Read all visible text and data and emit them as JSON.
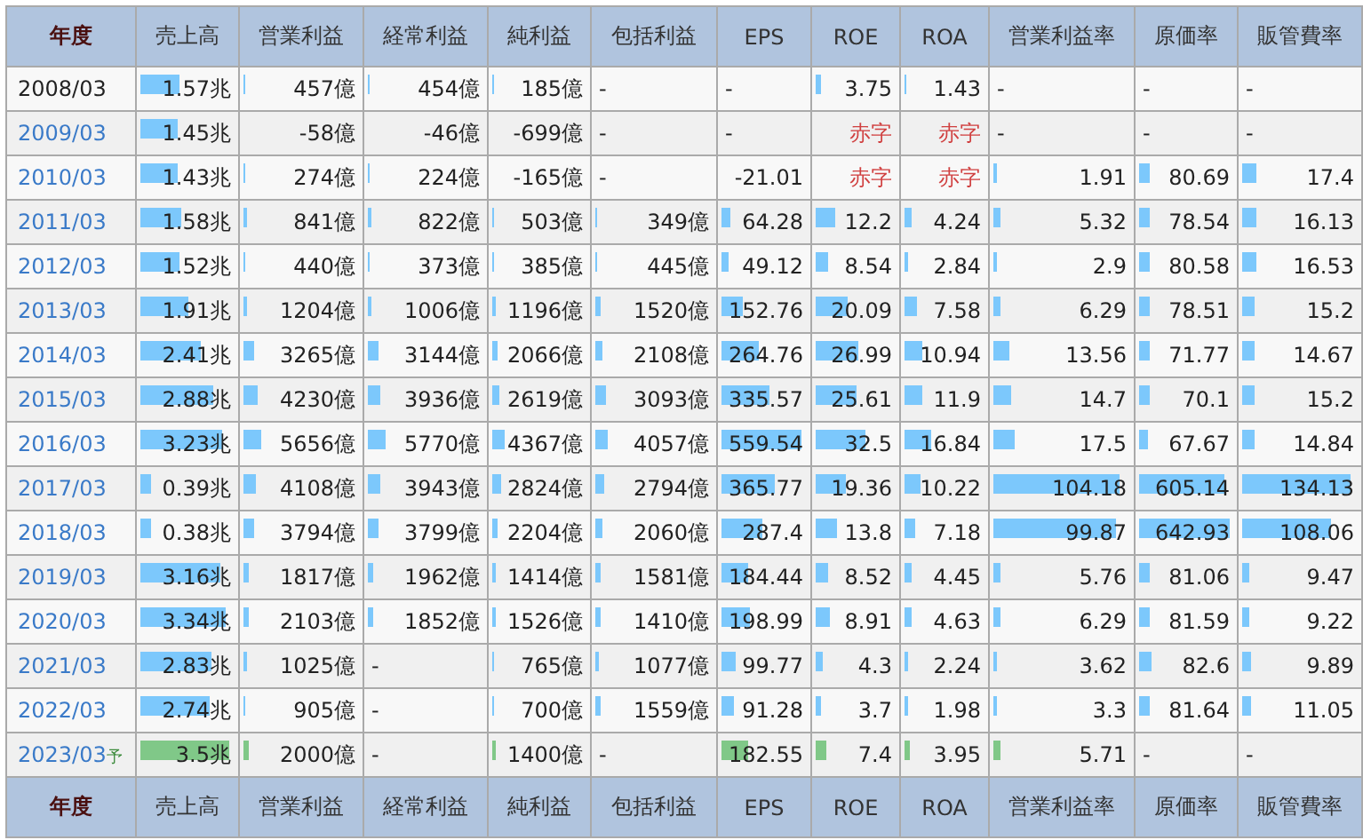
{
  "header": [
    "年度",
    "売上高",
    "営業利益",
    "経常利益",
    "純利益",
    "包括利益",
    "EPS",
    "ROE",
    "ROA",
    "営業利益率",
    "原価率",
    "販管費率"
  ],
  "rows": [
    {
      "year": "2008/03",
      "link": false,
      "forecast": false,
      "cells": [
        {
          "kind": "number",
          "text": "1.57兆",
          "level": 0.39
        },
        {
          "kind": "number",
          "text": "457億",
          "level": 0.02
        },
        {
          "kind": "number",
          "text": "454億",
          "level": 0.02
        },
        {
          "kind": "number",
          "text": "185億",
          "level": 0.02
        },
        {
          "kind": "dash",
          "text": "-"
        },
        {
          "kind": "dash",
          "text": "-"
        },
        {
          "kind": "number",
          "text": "3.75",
          "level": 0.07
        },
        {
          "kind": "number",
          "text": "1.43",
          "level": 0.03
        },
        {
          "kind": "dash",
          "text": "-"
        },
        {
          "kind": "dash",
          "text": "-"
        },
        {
          "kind": "dash",
          "text": "-"
        }
      ]
    },
    {
      "year": "2009/03",
      "link": true,
      "forecast": false,
      "cells": [
        {
          "kind": "number",
          "text": "1.45兆",
          "level": 0.36
        },
        {
          "kind": "number",
          "text": "-58億"
        },
        {
          "kind": "number",
          "text": "-46億"
        },
        {
          "kind": "number",
          "text": "-699億"
        },
        {
          "kind": "dash",
          "text": "-"
        },
        {
          "kind": "dash",
          "text": "-"
        },
        {
          "kind": "deficit",
          "text": "赤字"
        },
        {
          "kind": "deficit",
          "text": "赤字"
        },
        {
          "kind": "dash",
          "text": "-"
        },
        {
          "kind": "dash",
          "text": "-"
        },
        {
          "kind": "dash",
          "text": "-"
        }
      ]
    },
    {
      "year": "2010/03",
      "link": true,
      "forecast": false,
      "cells": [
        {
          "kind": "number",
          "text": "1.43兆",
          "level": 0.36
        },
        {
          "kind": "number",
          "text": "274億",
          "level": 0.02
        },
        {
          "kind": "number",
          "text": "224億",
          "level": 0.02
        },
        {
          "kind": "number",
          "text": "-165億"
        },
        {
          "kind": "dash",
          "text": "-"
        },
        {
          "kind": "number",
          "text": "-21.01"
        },
        {
          "kind": "deficit",
          "text": "赤字"
        },
        {
          "kind": "deficit",
          "text": "赤字"
        },
        {
          "kind": "number",
          "text": "1.91",
          "level": 0.02
        },
        {
          "kind": "number",
          "text": "80.69",
          "level": 0.11
        },
        {
          "kind": "number",
          "text": "17.4",
          "level": 0.12
        }
      ]
    },
    {
      "year": "2011/03",
      "link": true,
      "forecast": false,
      "cells": [
        {
          "kind": "number",
          "text": "1.58兆",
          "level": 0.4
        },
        {
          "kind": "number",
          "text": "841億",
          "level": 0.03
        },
        {
          "kind": "number",
          "text": "822億",
          "level": 0.03
        },
        {
          "kind": "number",
          "text": "503億",
          "level": 0.02
        },
        {
          "kind": "number",
          "text": "349億",
          "level": 0.02
        },
        {
          "kind": "number",
          "text": "64.28",
          "level": 0.1
        },
        {
          "kind": "number",
          "text": "12.2",
          "level": 0.22
        },
        {
          "kind": "number",
          "text": "4.24",
          "level": 0.08
        },
        {
          "kind": "number",
          "text": "5.32",
          "level": 0.05
        },
        {
          "kind": "number",
          "text": "78.54",
          "level": 0.11
        },
        {
          "kind": "number",
          "text": "16.13",
          "level": 0.11
        }
      ]
    },
    {
      "year": "2012/03",
      "link": true,
      "forecast": false,
      "cells": [
        {
          "kind": "number",
          "text": "1.52兆",
          "level": 0.38
        },
        {
          "kind": "number",
          "text": "440億",
          "level": 0.02
        },
        {
          "kind": "number",
          "text": "373億",
          "level": 0.02
        },
        {
          "kind": "number",
          "text": "385億",
          "level": 0.02
        },
        {
          "kind": "number",
          "text": "445億",
          "level": 0.02
        },
        {
          "kind": "number",
          "text": "49.12",
          "level": 0.08
        },
        {
          "kind": "number",
          "text": "8.54",
          "level": 0.15
        },
        {
          "kind": "number",
          "text": "2.84",
          "level": 0.05
        },
        {
          "kind": "number",
          "text": "2.9",
          "level": 0.03
        },
        {
          "kind": "number",
          "text": "80.58",
          "level": 0.11
        },
        {
          "kind": "number",
          "text": "16.53",
          "level": 0.11
        }
      ]
    },
    {
      "year": "2013/03",
      "link": true,
      "forecast": false,
      "cells": [
        {
          "kind": "number",
          "text": "1.91兆",
          "level": 0.48
        },
        {
          "kind": "number",
          "text": "1204億",
          "level": 0.03
        },
        {
          "kind": "number",
          "text": "1006億",
          "level": 0.03
        },
        {
          "kind": "number",
          "text": "1196億",
          "level": 0.03
        },
        {
          "kind": "number",
          "text": "1520億",
          "level": 0.04
        },
        {
          "kind": "number",
          "text": "152.76",
          "level": 0.24
        },
        {
          "kind": "number",
          "text": "20.09",
          "level": 0.36
        },
        {
          "kind": "number",
          "text": "7.58",
          "level": 0.14
        },
        {
          "kind": "number",
          "text": "6.29",
          "level": 0.05
        },
        {
          "kind": "number",
          "text": "78.51",
          "level": 0.11
        },
        {
          "kind": "number",
          "text": "15.2",
          "level": 0.1
        }
      ]
    },
    {
      "year": "2014/03",
      "link": true,
      "forecast": false,
      "cells": [
        {
          "kind": "number",
          "text": "2.41兆",
          "level": 0.6
        },
        {
          "kind": "number",
          "text": "3265億",
          "level": 0.08
        },
        {
          "kind": "number",
          "text": "3144億",
          "level": 0.08
        },
        {
          "kind": "number",
          "text": "2066億",
          "level": 0.06
        },
        {
          "kind": "number",
          "text": "2108億",
          "level": 0.05
        },
        {
          "kind": "number",
          "text": "264.76",
          "level": 0.41
        },
        {
          "kind": "number",
          "text": "26.99",
          "level": 0.48
        },
        {
          "kind": "number",
          "text": "10.94",
          "level": 0.2
        },
        {
          "kind": "number",
          "text": "13.56",
          "level": 0.11
        },
        {
          "kind": "number",
          "text": "71.77",
          "level": 0.1
        },
        {
          "kind": "number",
          "text": "14.67",
          "level": 0.1
        }
      ]
    },
    {
      "year": "2015/03",
      "link": true,
      "forecast": false,
      "cells": [
        {
          "kind": "number",
          "text": "2.88兆",
          "level": 0.72
        },
        {
          "kind": "number",
          "text": "4230億",
          "level": 0.11
        },
        {
          "kind": "number",
          "text": "3936億",
          "level": 0.1
        },
        {
          "kind": "number",
          "text": "2619億",
          "level": 0.07
        },
        {
          "kind": "number",
          "text": "3093億",
          "level": 0.08
        },
        {
          "kind": "number",
          "text": "335.57",
          "level": 0.52
        },
        {
          "kind": "number",
          "text": "25.61",
          "level": 0.46
        },
        {
          "kind": "number",
          "text": "11.9",
          "level": 0.21
        },
        {
          "kind": "number",
          "text": "14.7",
          "level": 0.12
        },
        {
          "kind": "number",
          "text": "70.1",
          "level": 0.1
        },
        {
          "kind": "number",
          "text": "15.2",
          "level": 0.1
        }
      ]
    },
    {
      "year": "2016/03",
      "link": true,
      "forecast": false,
      "cells": [
        {
          "kind": "number",
          "text": "3.23兆",
          "level": 0.81
        },
        {
          "kind": "number",
          "text": "5656億",
          "level": 0.14
        },
        {
          "kind": "number",
          "text": "5770億",
          "level": 0.14
        },
        {
          "kind": "number",
          "text": "4367億",
          "level": 0.12
        },
        {
          "kind": "number",
          "text": "4057億",
          "level": 0.1
        },
        {
          "kind": "number",
          "text": "559.54",
          "level": 0.87
        },
        {
          "kind": "number",
          "text": "32.5",
          "level": 0.58
        },
        {
          "kind": "number",
          "text": "16.84",
          "level": 0.3
        },
        {
          "kind": "number",
          "text": "17.5",
          "level": 0.15
        },
        {
          "kind": "number",
          "text": "67.67",
          "level": 0.09
        },
        {
          "kind": "number",
          "text": "14.84",
          "level": 0.1
        }
      ]
    },
    {
      "year": "2017/03",
      "link": true,
      "forecast": false,
      "cells": [
        {
          "kind": "number",
          "text": "0.39兆",
          "level": 0.1
        },
        {
          "kind": "number",
          "text": "4108億",
          "level": 0.1
        },
        {
          "kind": "number",
          "text": "3943億",
          "level": 0.1
        },
        {
          "kind": "number",
          "text": "2824億",
          "level": 0.08
        },
        {
          "kind": "number",
          "text": "2794億",
          "level": 0.07
        },
        {
          "kind": "number",
          "text": "365.77",
          "level": 0.57
        },
        {
          "kind": "number",
          "text": "19.36",
          "level": 0.35
        },
        {
          "kind": "number",
          "text": "10.22",
          "level": 0.18
        },
        {
          "kind": "number",
          "text": "104.18",
          "level": 0.88
        },
        {
          "kind": "number",
          "text": "605.14",
          "level": 0.85
        },
        {
          "kind": "number",
          "text": "134.13",
          "level": 0.89
        }
      ]
    },
    {
      "year": "2018/03",
      "link": true,
      "forecast": false,
      "cells": [
        {
          "kind": "number",
          "text": "0.38兆",
          "level": 0.1
        },
        {
          "kind": "number",
          "text": "3794億",
          "level": 0.09
        },
        {
          "kind": "number",
          "text": "3799億",
          "level": 0.09
        },
        {
          "kind": "number",
          "text": "2204億",
          "level": 0.06
        },
        {
          "kind": "number",
          "text": "2060億",
          "level": 0.05
        },
        {
          "kind": "number",
          "text": "287.4",
          "level": 0.45
        },
        {
          "kind": "number",
          "text": "13.8",
          "level": 0.25
        },
        {
          "kind": "number",
          "text": "7.18",
          "level": 0.13
        },
        {
          "kind": "number",
          "text": "99.87",
          "level": 0.85
        },
        {
          "kind": "number",
          "text": "642.93",
          "level": 0.9
        },
        {
          "kind": "number",
          "text": "108.06",
          "level": 0.72
        }
      ]
    },
    {
      "year": "2019/03",
      "link": true,
      "forecast": false,
      "cells": [
        {
          "kind": "number",
          "text": "3.16兆",
          "level": 0.79
        },
        {
          "kind": "number",
          "text": "1817億",
          "level": 0.05
        },
        {
          "kind": "number",
          "text": "1962億",
          "level": 0.05
        },
        {
          "kind": "number",
          "text": "1414億",
          "level": 0.04
        },
        {
          "kind": "number",
          "text": "1581億",
          "level": 0.04
        },
        {
          "kind": "number",
          "text": "184.44",
          "level": 0.29
        },
        {
          "kind": "number",
          "text": "8.52",
          "level": 0.15
        },
        {
          "kind": "number",
          "text": "4.45",
          "level": 0.08
        },
        {
          "kind": "number",
          "text": "5.76",
          "level": 0.05
        },
        {
          "kind": "number",
          "text": "81.06",
          "level": 0.11
        },
        {
          "kind": "number",
          "text": "9.47",
          "level": 0.06
        }
      ]
    },
    {
      "year": "2020/03",
      "link": true,
      "forecast": false,
      "cells": [
        {
          "kind": "number",
          "text": "3.34兆",
          "level": 0.84
        },
        {
          "kind": "number",
          "text": "2103億",
          "level": 0.05
        },
        {
          "kind": "number",
          "text": "1852億",
          "level": 0.05
        },
        {
          "kind": "number",
          "text": "1526億",
          "level": 0.04
        },
        {
          "kind": "number",
          "text": "1410億",
          "level": 0.04
        },
        {
          "kind": "number",
          "text": "198.99",
          "level": 0.31
        },
        {
          "kind": "number",
          "text": "8.91",
          "level": 0.16
        },
        {
          "kind": "number",
          "text": "4.63",
          "level": 0.08
        },
        {
          "kind": "number",
          "text": "6.29",
          "level": 0.05
        },
        {
          "kind": "number",
          "text": "81.59",
          "level": 0.11
        },
        {
          "kind": "number",
          "text": "9.22",
          "level": 0.06
        }
      ]
    },
    {
      "year": "2021/03",
      "link": true,
      "forecast": false,
      "cells": [
        {
          "kind": "number",
          "text": "2.83兆",
          "level": 0.71
        },
        {
          "kind": "number",
          "text": "1025億",
          "level": 0.03
        },
        {
          "kind": "dash",
          "text": "-"
        },
        {
          "kind": "number",
          "text": "765億",
          "level": 0.02
        },
        {
          "kind": "number",
          "text": "1077億",
          "level": 0.03
        },
        {
          "kind": "number",
          "text": "99.77",
          "level": 0.16
        },
        {
          "kind": "number",
          "text": "4.3",
          "level": 0.08
        },
        {
          "kind": "number",
          "text": "2.24",
          "level": 0.04
        },
        {
          "kind": "number",
          "text": "3.62",
          "level": 0.03
        },
        {
          "kind": "number",
          "text": "82.6",
          "level": 0.12
        },
        {
          "kind": "number",
          "text": "9.89",
          "level": 0.07
        }
      ]
    },
    {
      "year": "2022/03",
      "link": true,
      "forecast": false,
      "cells": [
        {
          "kind": "number",
          "text": "2.74兆",
          "level": 0.69
        },
        {
          "kind": "number",
          "text": "905億",
          "level": 0.02
        },
        {
          "kind": "dash",
          "text": "-"
        },
        {
          "kind": "number",
          "text": "700億",
          "level": 0.02
        },
        {
          "kind": "number",
          "text": "1559億",
          "level": 0.04
        },
        {
          "kind": "number",
          "text": "91.28",
          "level": 0.14
        },
        {
          "kind": "number",
          "text": "3.7",
          "level": 0.07
        },
        {
          "kind": "number",
          "text": "1.98",
          "level": 0.04
        },
        {
          "kind": "number",
          "text": "3.3",
          "level": 0.03
        },
        {
          "kind": "number",
          "text": "81.64",
          "level": 0.11
        },
        {
          "kind": "number",
          "text": "11.05",
          "level": 0.07
        }
      ]
    },
    {
      "year": "2023/03",
      "note": "予",
      "link": true,
      "forecast": true,
      "cells": [
        {
          "kind": "number",
          "text": "3.5兆",
          "level": 0.88
        },
        {
          "kind": "number",
          "text": "2000億",
          "level": 0.05
        },
        {
          "kind": "dash",
          "text": "-"
        },
        {
          "kind": "number",
          "text": "1400億",
          "level": 0.04
        },
        {
          "kind": "dash",
          "text": "-"
        },
        {
          "kind": "number",
          "text": "182.55",
          "level": 0.29
        },
        {
          "kind": "number",
          "text": "7.4",
          "level": 0.13
        },
        {
          "kind": "number",
          "text": "3.95",
          "level": 0.07
        },
        {
          "kind": "number",
          "text": "5.71",
          "level": 0.05
        },
        {
          "kind": "dash",
          "text": "-"
        },
        {
          "kind": "dash",
          "text": "-"
        }
      ]
    }
  ],
  "footer": [
    "年度",
    "売上高",
    "営業利益",
    "経常利益",
    "純利益",
    "包括利益",
    "EPS",
    "ROE",
    "ROA",
    "営業利益率",
    "原価率",
    "販管費率"
  ]
}
